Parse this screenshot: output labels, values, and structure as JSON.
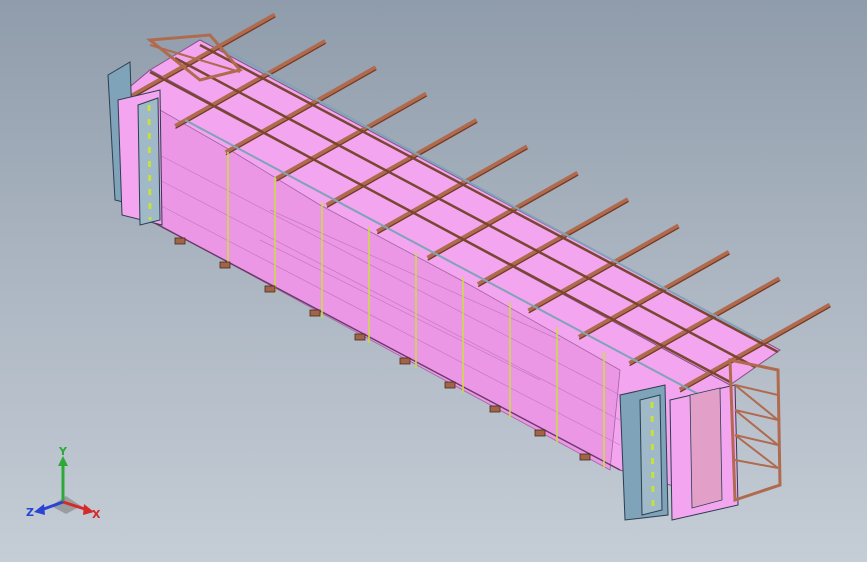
{
  "viewport": {
    "background_top": "#8f9cab",
    "background_bottom": "#c5cdd6"
  },
  "model": {
    "type": "box-girder formwork assembly",
    "colors": {
      "panel": "#f3a6ef",
      "panel_dark": "#d98ad6",
      "steel": "#b06a4e",
      "steel_dark": "#6e3b2a",
      "frame": "#7fa3b8",
      "tie_rod": "#c8e03a",
      "support": "#a06548"
    }
  },
  "triad": {
    "x_label": "X",
    "y_label": "Y",
    "z_label": "Z",
    "x_color": "#d42a2a",
    "y_color": "#2fa83a",
    "z_color": "#2a43d4"
  }
}
